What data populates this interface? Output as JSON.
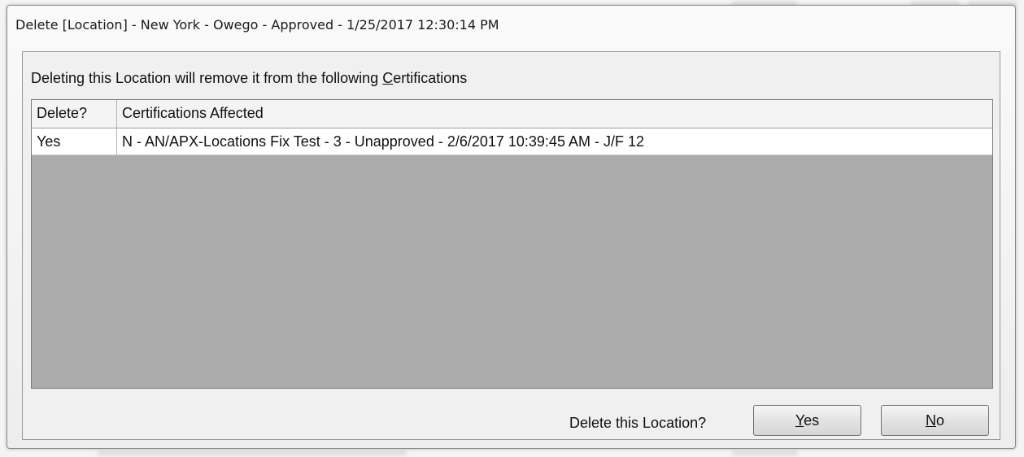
{
  "window": {
    "title": "Delete [Location] - New York - Owego - Approved - 1/25/2017 12:30:14 PM"
  },
  "prompt": {
    "before": "Deleting this Location will remove it from the following ",
    "accel": "C",
    "after": "ertifications"
  },
  "grid": {
    "columns": [
      "Delete?",
      "Certifications Affected"
    ],
    "rows": [
      [
        "Yes",
        "N - AN/APX-Locations Fix Test - 3 - Unapproved - 2/6/2017 10:39:45 AM - J/F 12"
      ]
    ]
  },
  "footer": {
    "question": "Delete this Location?",
    "yes": {
      "accel": "Y",
      "rest": "es"
    },
    "no": {
      "accel": "N",
      "rest": "o"
    }
  },
  "colors": {
    "grid_empty_area": "#ababab",
    "row_background": "#ffffff"
  }
}
